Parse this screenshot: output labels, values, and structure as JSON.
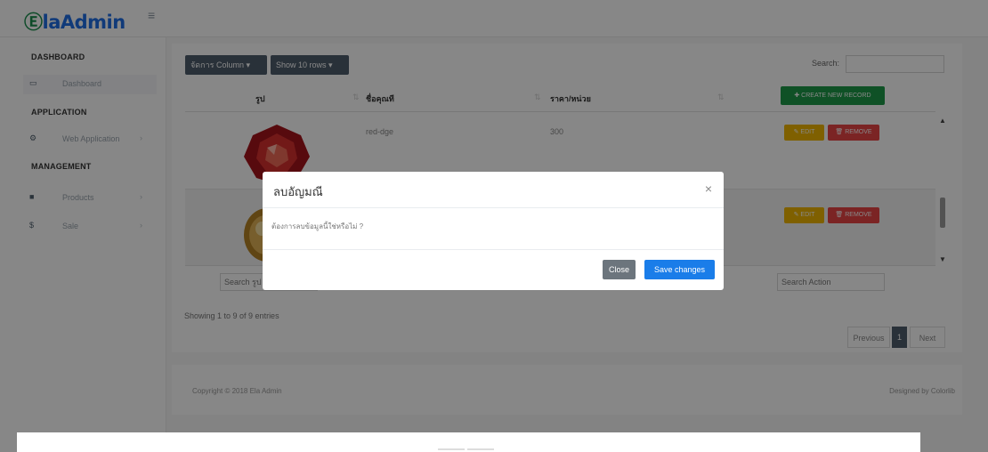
{
  "brand": {
    "logo_text": "laAdmin",
    "logo_prefix": "e"
  },
  "sidebar": {
    "sections": [
      {
        "heading": "DASHBOARD"
      },
      {
        "heading": "APPLICATION"
      },
      {
        "heading": "MANAGEMENT"
      }
    ],
    "items": [
      {
        "label": "Dashboard",
        "icon": "laptop-icon"
      },
      {
        "label": "Web Application",
        "icon": "gears-icon"
      },
      {
        "label": "Products",
        "icon": "box-icon"
      },
      {
        "label": "Sale",
        "icon": "dollar-icon"
      }
    ]
  },
  "toolbar": {
    "columns_btn": "จัดการ Column ▾",
    "show_btn": "Show 10 rows ▾",
    "search_label": "Search:"
  },
  "table": {
    "headers": [
      "รูป",
      "ชื่อคุณที",
      "ราคา/หน่วย"
    ],
    "create_btn": "✚ CREATE NEW RECORD",
    "rows": [
      {
        "name": "red-dge",
        "price": "300",
        "edit": "✎ EDIT",
        "remove": "🗑 REMOVE"
      },
      {
        "name": "",
        "price": "",
        "edit": "✎ EDIT",
        "remove": "🗑 REMOVE"
      }
    ],
    "footer_search_image": "Search รูป",
    "footer_search_action": "Search Action",
    "showing": "Showing 1 to 9 of 9 entries"
  },
  "pagination": {
    "previous": "Previous",
    "current": "1",
    "next": "Next"
  },
  "footer": {
    "copyright": "Copyright © 2018 Ela Admin",
    "designed": "Designed by Colorlib"
  },
  "modal": {
    "title": "ลบอัญมณี",
    "close_symbol": "×",
    "body": "ต้องการลบข้อมูลนี้ใช่หรือไม่ ?",
    "close_btn": "Close",
    "save_btn": "Save changes"
  },
  "colors": {
    "brand_green": "#1b8f4e",
    "brand_blue": "#1f6fe5",
    "create_green": "#1e9a48",
    "edit_yellow": "#f0b600",
    "remove_red": "#e84444",
    "save_blue": "#1a7de9"
  }
}
